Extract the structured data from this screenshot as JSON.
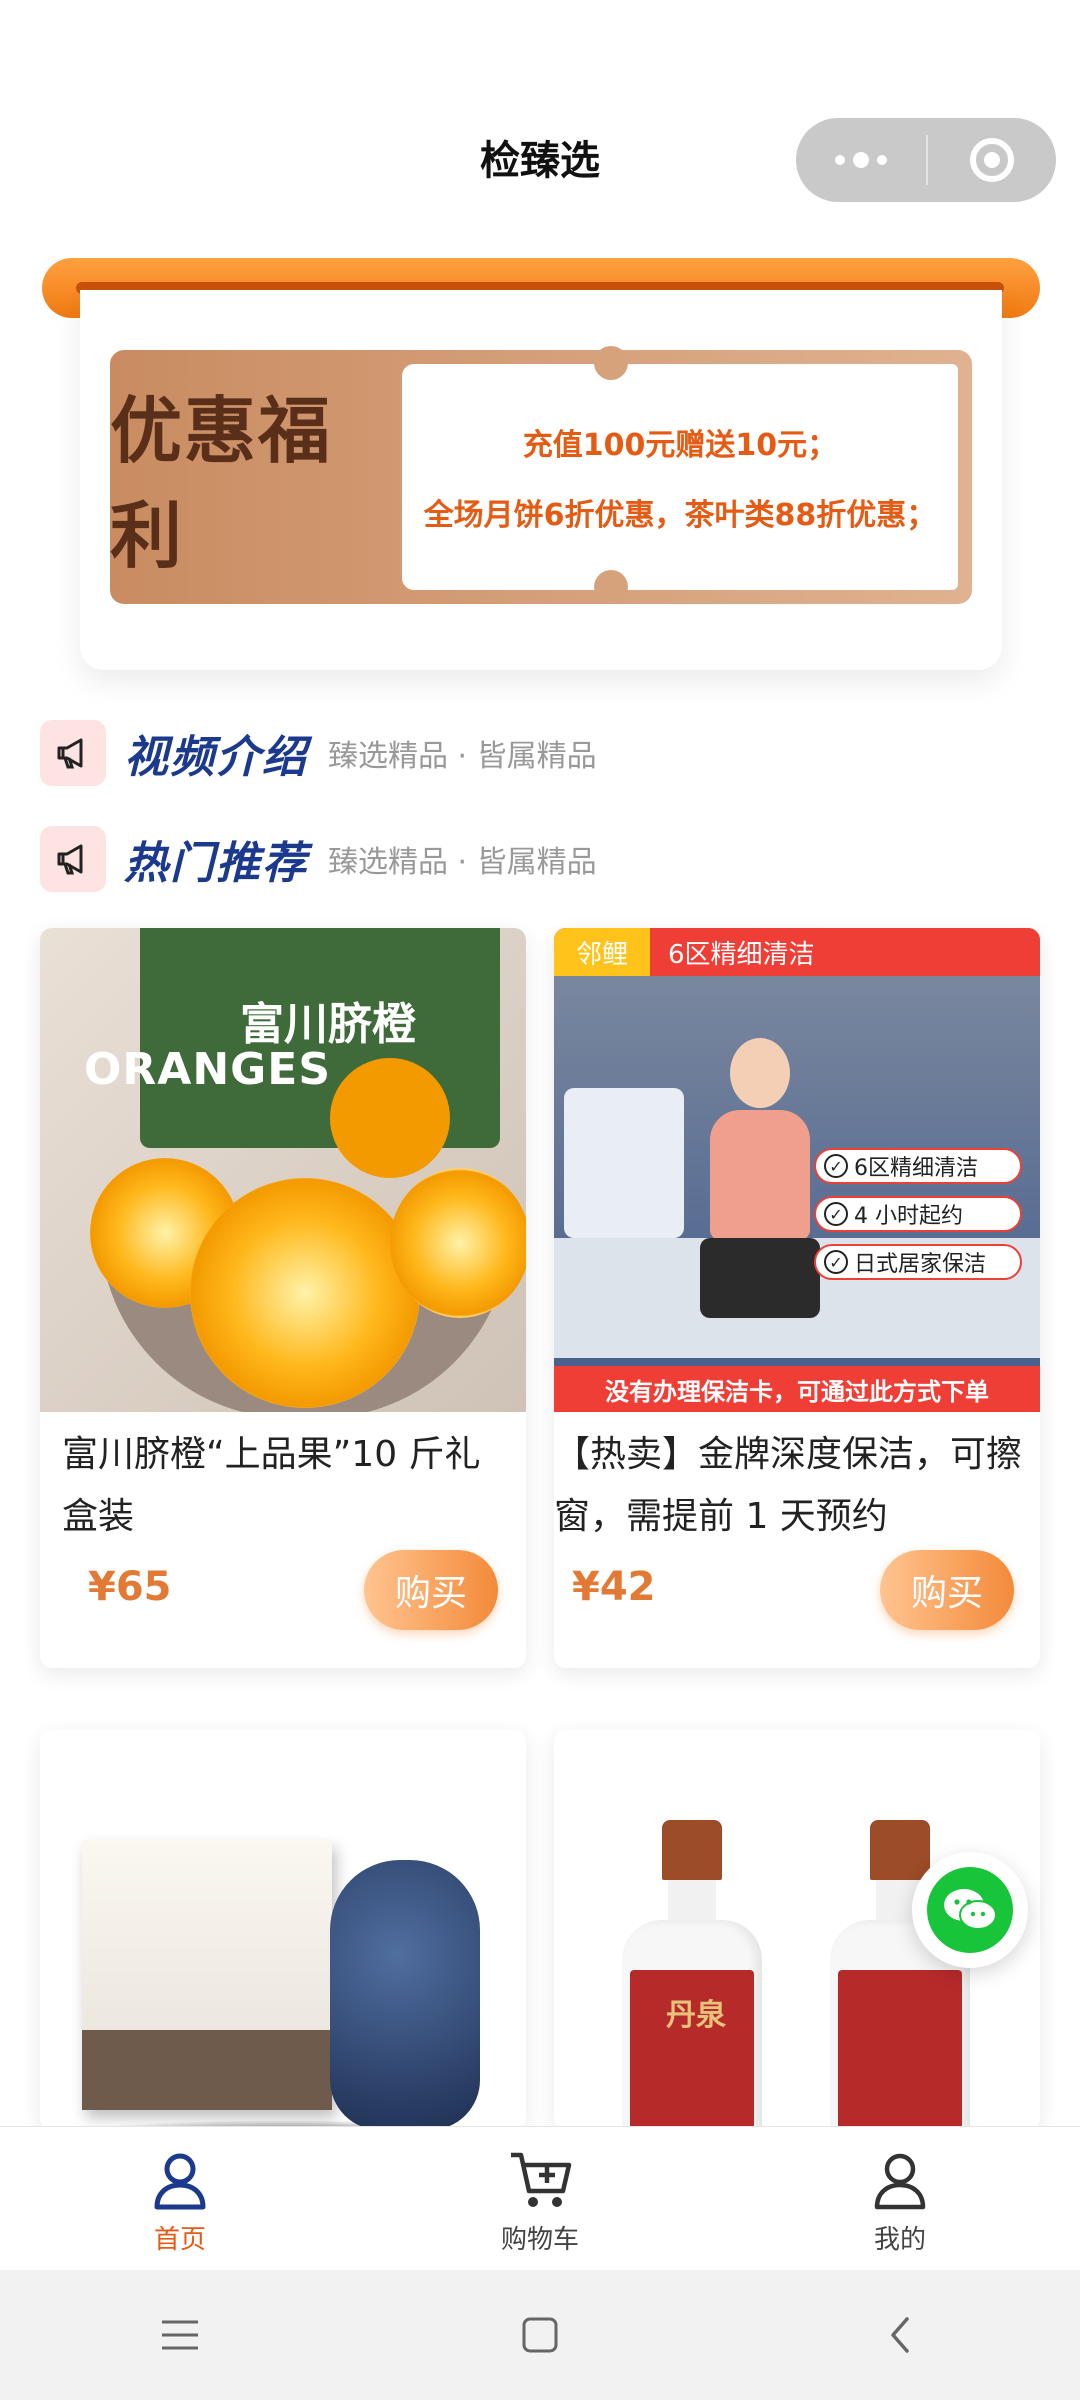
{
  "header": {
    "title": "检臻选"
  },
  "promo": {
    "badge": "优惠福利",
    "line1": "充值100元赠送10元；",
    "line2": "全场月饼6折优惠，茶叶类88折优惠；"
  },
  "sections": [
    {
      "title": "视频介绍",
      "subtitle": "臻选精品 · 皆属精品"
    },
    {
      "title": "热门推荐",
      "subtitle": "臻选精品 · 皆属精品"
    }
  ],
  "products": [
    {
      "name": "富川脐橙“上品果”10 斤礼盒装",
      "price": "¥65",
      "buy_label": "购买",
      "image_text": {
        "box_label": "富川脐橙",
        "word": "ORANGES"
      }
    },
    {
      "name": "【热卖】金牌深度保洁，可擦窗，需提前 1 天预约",
      "price": "¥42",
      "buy_label": "购买",
      "image_text": {
        "tag1": "邻鲤",
        "tag2": "6区精细清洁",
        "check1": "6区精细清洁",
        "check2": "4 小时起约",
        "check3": "日式居家保洁",
        "bottom": "没有办理保洁卡，可通过此方式下单"
      }
    },
    {
      "name": "",
      "price": "",
      "buy_label": ""
    },
    {
      "name": "",
      "price": "",
      "buy_label": "",
      "image_text": {
        "logo": "丹泉"
      }
    }
  ],
  "tabbar": [
    {
      "label": "首页",
      "active": true
    },
    {
      "label": "购物车",
      "active": false
    },
    {
      "label": "我的",
      "active": false
    }
  ],
  "colors": {
    "accent": "#e55b13",
    "section_title": "#1b3a8e",
    "active_icon": "#1b3a8e",
    "wechat": "#18c43a"
  },
  "icons": {
    "menu": "more-dots-icon",
    "close": "close-circle-icon",
    "section": "megaphone-icon",
    "float": "wechat-icon",
    "tab_home": "user-icon",
    "tab_cart": "cart-add-icon",
    "tab_mine": "user-outline-icon"
  }
}
